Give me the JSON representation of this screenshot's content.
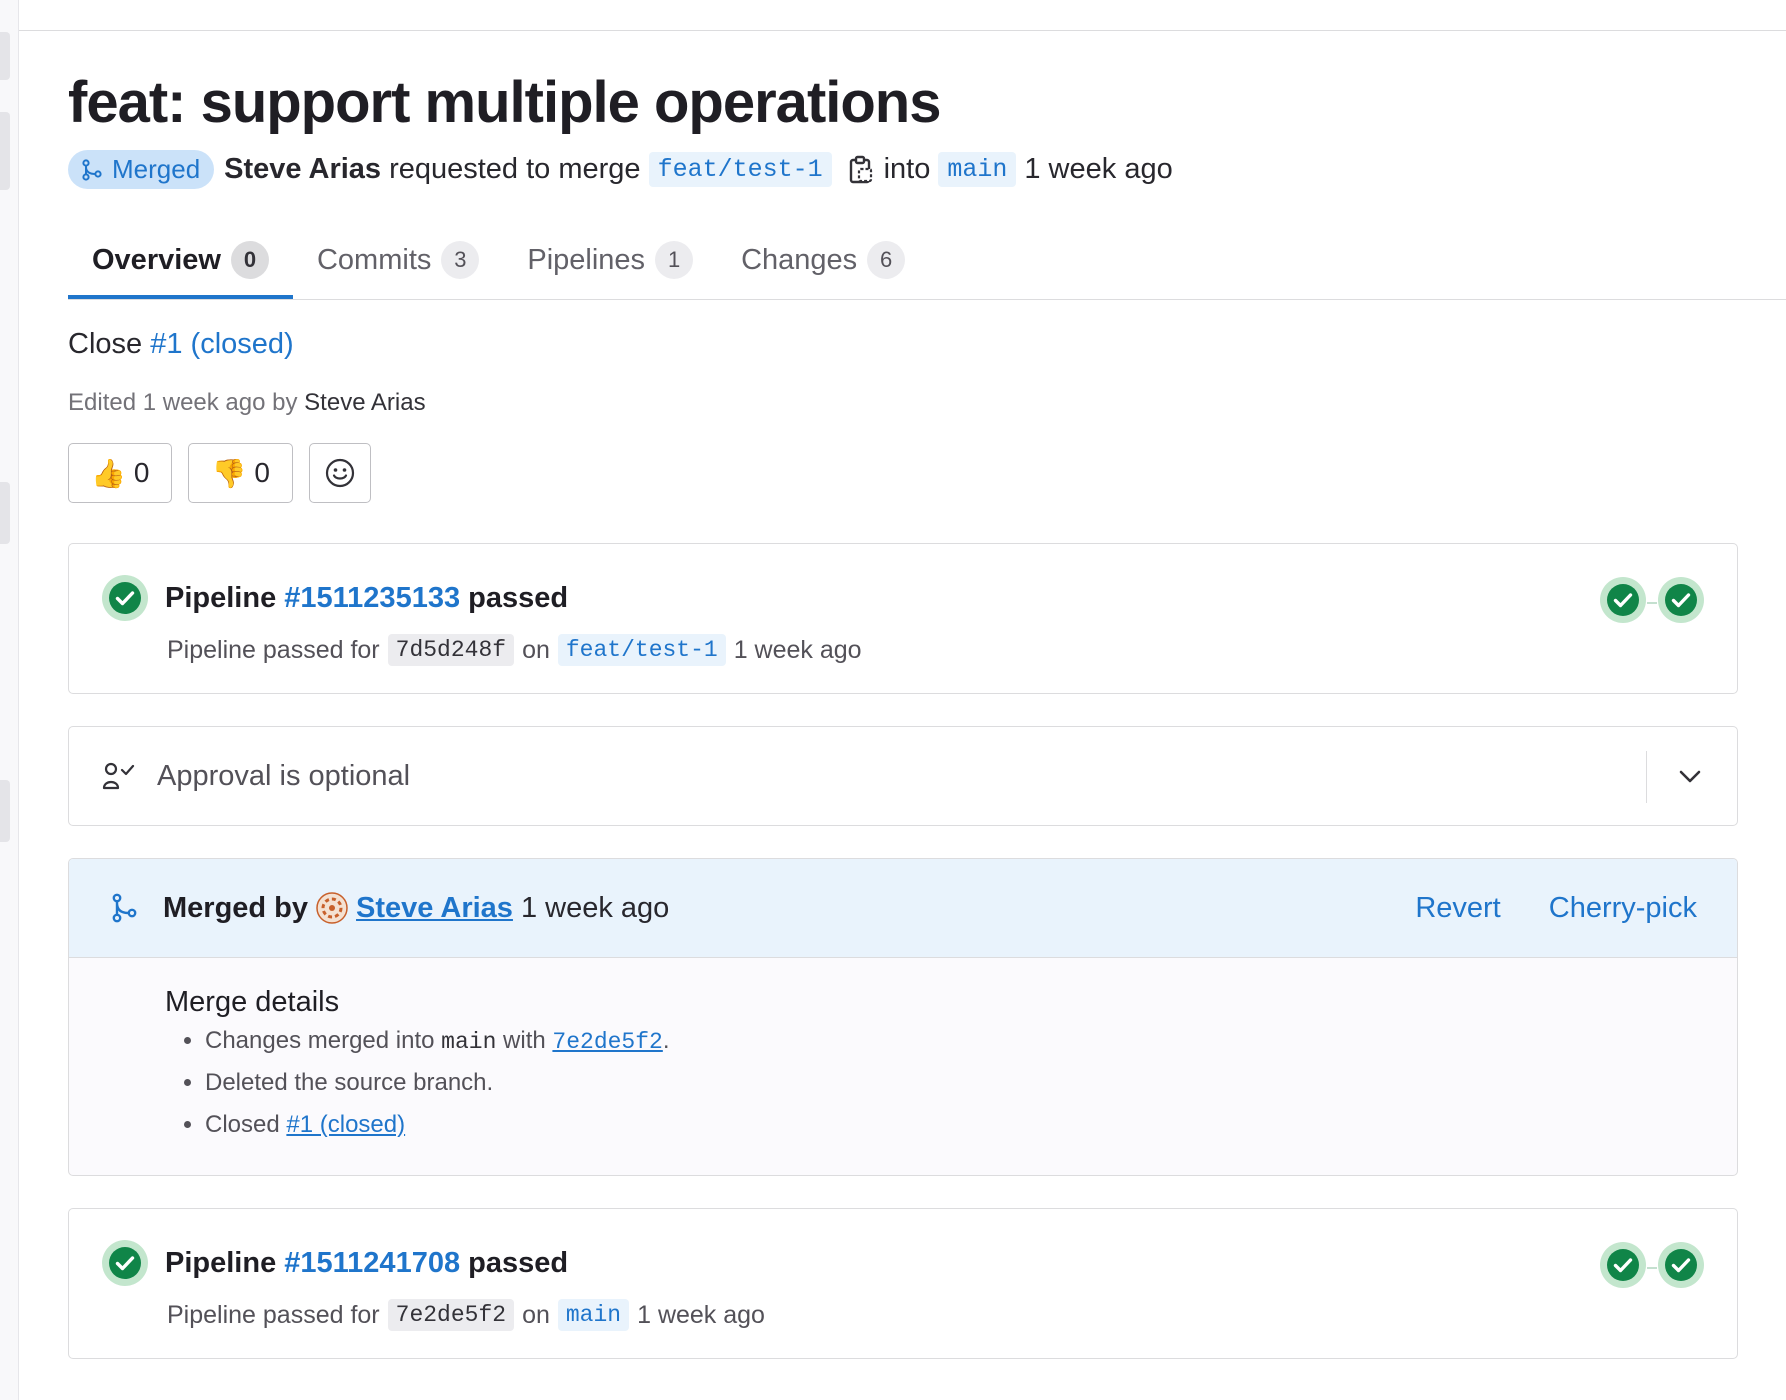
{
  "title": "feat: support multiple operations",
  "meta": {
    "status": "Merged",
    "author": "Steve Arias",
    "action": "requested to merge",
    "source_branch": "feat/test-1",
    "into": "into",
    "target_branch": "main",
    "time": "1 week ago"
  },
  "tabs": [
    {
      "label": "Overview",
      "count": "0"
    },
    {
      "label": "Commits",
      "count": "3"
    },
    {
      "label": "Pipelines",
      "count": "1"
    },
    {
      "label": "Changes",
      "count": "6"
    }
  ],
  "description": {
    "prefix": "Close",
    "link": "#1 (closed)"
  },
  "edited": {
    "prefix": "Edited 1 week ago by",
    "by": "Steve Arias"
  },
  "reactions": {
    "thumbs_up": "0",
    "thumbs_down": "0"
  },
  "pipeline1": {
    "label": "Pipeline",
    "id": "#1511235133",
    "status": "passed",
    "detail_prefix": "Pipeline passed for",
    "sha": "7d5d248f",
    "on": "on",
    "branch": "feat/test-1",
    "time": "1 week ago"
  },
  "approval": {
    "text": "Approval is optional"
  },
  "merged": {
    "label": "Merged by",
    "user": "Steve Arias",
    "time": "1 week ago",
    "revert": "Revert",
    "cherry_pick": "Cherry-pick",
    "details_title": "Merge details",
    "item1_prefix": "Changes merged into",
    "item1_branch": "main",
    "item1_with": "with",
    "item1_sha": "7e2de5f2",
    "item1_end": ".",
    "item2": "Deleted the source branch.",
    "item3_prefix": "Closed",
    "item3_link": "#1 (closed)"
  },
  "pipeline2": {
    "label": "Pipeline",
    "id": "#1511241708",
    "status": "passed",
    "detail_prefix": "Pipeline passed for",
    "sha": "7e2de5f2",
    "on": "on",
    "branch": "main",
    "time": "1 week ago"
  },
  "colors": {
    "accent": "#1f75cb",
    "success": "#108548",
    "merged_bg": "#cbe2f9"
  }
}
